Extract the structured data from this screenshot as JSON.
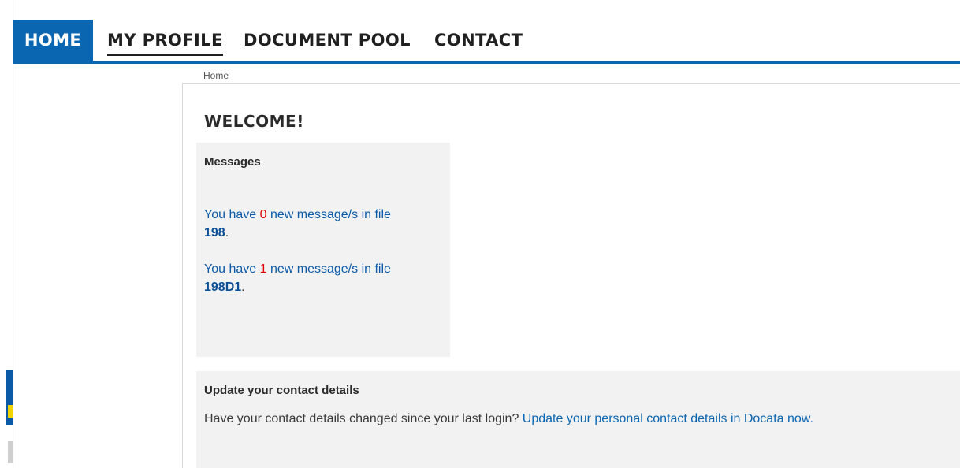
{
  "navigation": {
    "items": [
      {
        "label": "HOME",
        "active": true
      },
      {
        "label": "MY PROFILE",
        "active": false
      },
      {
        "label": "DOCUMENT POOL",
        "active": false
      },
      {
        "label": "CONTACT",
        "active": false
      }
    ]
  },
  "breadcrumb": {
    "current": "Home"
  },
  "page": {
    "title": "WELCOME!"
  },
  "messages_panel": {
    "title": "Messages",
    "entries": [
      {
        "prefix": "You have",
        "count": "0",
        "middle": "new message/s in file",
        "file": "198",
        "suffix": "."
      },
      {
        "prefix": "You have",
        "count": "1",
        "middle": "new message/s in file",
        "file": "198D1",
        "suffix": "."
      }
    ]
  },
  "contact_panel": {
    "title": "Update your contact details",
    "text": "Have your contact details changed since your last login?",
    "link_text": "Update your personal contact details in Docata now."
  },
  "colors": {
    "brand_blue": "#0b66b2",
    "link_blue": "#0b5aa8",
    "count_red": "#e00000",
    "panel_gray": "#f2f2f2"
  }
}
